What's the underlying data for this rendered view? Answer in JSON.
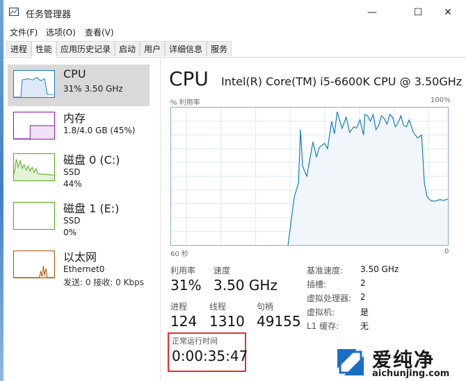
{
  "window": {
    "title": "任务管理器",
    "minimize": "—",
    "maximize": "☐",
    "close": "✕"
  },
  "menu": [
    "文件(F)",
    "选项(O)",
    "查看(V)"
  ],
  "tabs": [
    "进程",
    "性能",
    "应用历史记录",
    "启动",
    "用户",
    "详细信息",
    "服务"
  ],
  "active_tab": "性能",
  "sidebar": {
    "cpu": {
      "title": "CPU",
      "sub1": "31%  3.50 GHz"
    },
    "memory": {
      "title": "内存",
      "sub1": "1.8/4.0 GB (45%)"
    },
    "disk0": {
      "title": "磁盘 0 (C:)",
      "sub1": "SSD",
      "sub2": "44%"
    },
    "disk1": {
      "title": "磁盘 1 (E:)",
      "sub1": "SSD",
      "sub2": "0%"
    },
    "ethernet": {
      "title": "以太网",
      "sub1": "Ethernet0",
      "sub2": "发送: 0  接收: 0 Kbps"
    }
  },
  "main": {
    "title": "CPU",
    "model": "Intel(R) Core(TM) i5-6600K CPU @ 3.50GHz",
    "graph_label_left": "% 利用率",
    "graph_label_right": "100%",
    "axis_left": "60 秒",
    "axis_right": "0",
    "stats": {
      "util_label": "利用率",
      "util_value": "31%",
      "speed_label": "速度",
      "speed_value": "3.50 GHz",
      "proc_label": "进程",
      "proc_value": "124",
      "thread_label": "线程",
      "thread_value": "1310",
      "handle_label": "句柄",
      "handle_value": "49155",
      "uptime_label": "正常运行时间",
      "uptime_value": "0:00:35:47"
    },
    "details": [
      {
        "k": "基准速度:",
        "v": "3.50 GHz"
      },
      {
        "k": "插槽:",
        "v": "2"
      },
      {
        "k": "虚拟处理器:",
        "v": "2"
      },
      {
        "k": "虚拟机:",
        "v": "是"
      },
      {
        "k": "L1 缓存:",
        "v": "无"
      }
    ]
  },
  "watermark": {
    "brand": "爱纯净",
    "url": "aichunjing.com"
  },
  "colors": {
    "cpu_line": "#117dbb",
    "cpu_fill": "#f1f6fa",
    "mem": "#8b12ae",
    "disk": "#4da60c",
    "eth": "#a74f01",
    "highlight": "#e0302f"
  }
}
